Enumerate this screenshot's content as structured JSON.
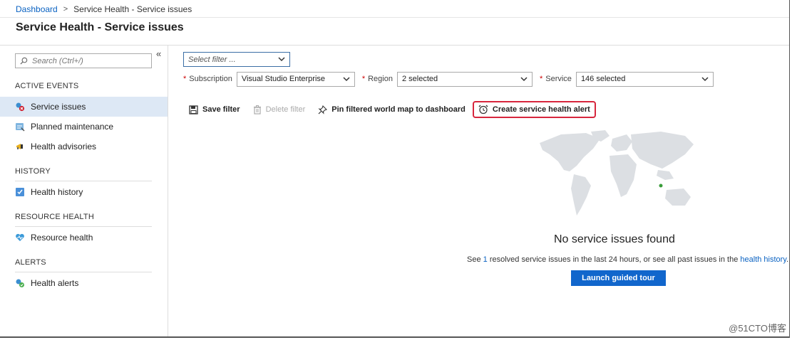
{
  "breadcrumb": {
    "root": "Dashboard",
    "separator": ">",
    "current": "Service Health - Service issues"
  },
  "page_title": "Service Health - Service issues",
  "sidebar": {
    "collapse_glyph": "«",
    "search_placeholder": "Search (Ctrl+/)",
    "sections": {
      "active_events": "ACTIVE EVENTS",
      "history": "HISTORY",
      "resource_health": "RESOURCE HEALTH",
      "alerts": "ALERTS"
    },
    "items": {
      "service_issues": "Service issues",
      "planned_maintenance": "Planned maintenance",
      "health_advisories": "Health advisories",
      "health_history": "Health history",
      "resource_health": "Resource health",
      "health_alerts": "Health alerts"
    }
  },
  "filters": {
    "select_filter_placeholder": "Select filter ...",
    "required_mark": "*",
    "subscription_label": "Subscription",
    "subscription_value": "Visual Studio Enterprise",
    "region_label": "Region",
    "region_value": "2 selected",
    "service_label": "Service",
    "service_value": "146 selected"
  },
  "toolbar": {
    "save_filter": "Save filter",
    "delete_filter": "Delete filter",
    "pin_map": "Pin filtered world map to dashboard",
    "create_alert": "Create service health alert"
  },
  "empty_state": {
    "title": "No service issues found",
    "desc_prefix": "See ",
    "resolved_count": "1",
    "desc_middle": " resolved service issues in the last 24 hours, or see all past issues in the ",
    "history_link": "health history",
    "desc_suffix": ".",
    "tour_button": "Launch guided tour"
  },
  "colors": {
    "accent": "#1166cc",
    "link": "#0a62c2",
    "highlight_border": "#d7263d",
    "active_nav": "#dde8f5",
    "map_land": "#dcdfe3",
    "map_marker": "#3a9d3a"
  },
  "watermark": "@51CTO博客"
}
